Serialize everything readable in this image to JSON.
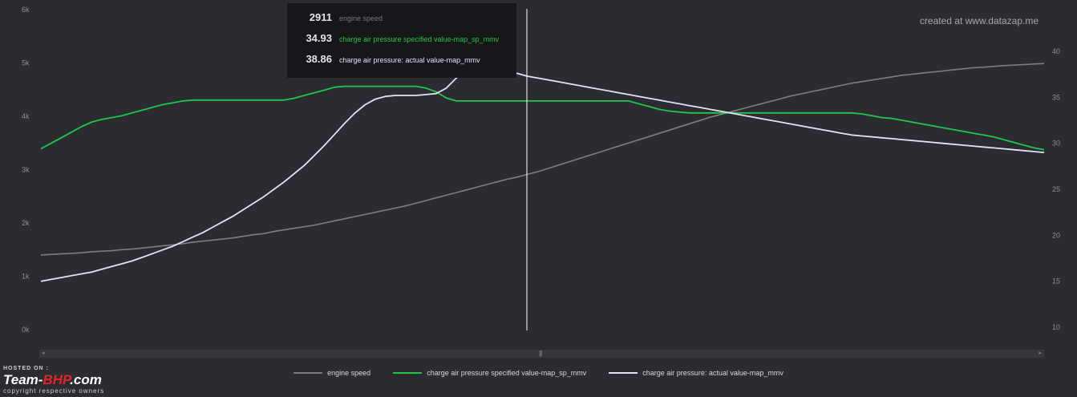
{
  "watermark": "created at www.datazap.me",
  "tooltip": {
    "rows": [
      {
        "value": "2911",
        "name": "engine speed",
        "color": "#8b8b8f"
      },
      {
        "value": "34.93",
        "name": "charge air pressure specified value-map_sp_mmv",
        "color": "#21c64a"
      },
      {
        "value": "38.86",
        "name": "charge air pressure: actual value-map_mmv",
        "color": "#e4e1f5"
      }
    ]
  },
  "scrollbar": {
    "left_arrow": "◂",
    "right_arrow": "▸",
    "grip": "|||"
  },
  "brand": {
    "hosted": "HOSTED ON :",
    "name_a": "Team-",
    "name_b": "BHP",
    "name_c": ".com",
    "copyright": "copyright respective owners"
  },
  "chart_data": {
    "type": "line",
    "x_count": 100,
    "cursor_index": 39,
    "left_axis": {
      "min": 0,
      "max": 6000,
      "ticks": [
        0,
        1000,
        2000,
        3000,
        4000,
        5000,
        6000
      ],
      "tick_labels": [
        "0k",
        "1k",
        "2k",
        "3k",
        "4k",
        "5k",
        "6k"
      ]
    },
    "right_axis": {
      "min": 10,
      "max": 40,
      "ticks": [
        10,
        15,
        20,
        25,
        30,
        35,
        40
      ],
      "tick_labels": [
        "10",
        "15",
        "20",
        "25",
        "30",
        "35",
        "40"
      ]
    },
    "legend": [
      "engine speed",
      "charge air pressure specified value-map_sp_mmv",
      "charge air pressure: actual value-map_mmv"
    ],
    "series": [
      {
        "name": "engine speed",
        "axis": "left",
        "color": "#7e7e82",
        "values": [
          1400,
          1410,
          1420,
          1430,
          1440,
          1460,
          1470,
          1480,
          1500,
          1510,
          1530,
          1550,
          1570,
          1590,
          1610,
          1640,
          1660,
          1680,
          1700,
          1720,
          1750,
          1780,
          1800,
          1840,
          1870,
          1900,
          1930,
          1960,
          2000,
          2040,
          2080,
          2120,
          2160,
          2200,
          2240,
          2280,
          2320,
          2370,
          2420,
          2470,
          2520,
          2570,
          2620,
          2670,
          2720,
          2770,
          2820,
          2860,
          2911,
          2960,
          3020,
          3080,
          3140,
          3200,
          3260,
          3320,
          3380,
          3440,
          3500,
          3560,
          3620,
          3680,
          3740,
          3800,
          3860,
          3920,
          3980,
          4030,
          4080,
          4130,
          4180,
          4230,
          4280,
          4330,
          4380,
          4420,
          4460,
          4500,
          4540,
          4580,
          4620,
          4650,
          4680,
          4710,
          4740,
          4770,
          4790,
          4810,
          4830,
          4850,
          4870,
          4890,
          4910,
          4920,
          4935,
          4950,
          4960,
          4970,
          4980,
          4990
        ]
      },
      {
        "name": "charge air pressure specified value-map_sp_mmv",
        "axis": "right",
        "color": "#21c64a",
        "values": [
          29.4,
          30.0,
          30.6,
          31.2,
          31.8,
          32.3,
          32.6,
          32.8,
          33.0,
          33.3,
          33.6,
          33.9,
          34.2,
          34.4,
          34.6,
          34.7,
          34.7,
          34.7,
          34.7,
          34.7,
          34.7,
          34.7,
          34.7,
          34.7,
          34.7,
          34.9,
          35.2,
          35.5,
          35.8,
          36.1,
          36.2,
          36.2,
          36.2,
          36.2,
          36.2,
          36.2,
          36.2,
          36.2,
          36.0,
          35.6,
          34.93,
          34.6,
          34.6,
          34.6,
          34.6,
          34.6,
          34.6,
          34.6,
          34.6,
          34.6,
          34.6,
          34.6,
          34.6,
          34.6,
          34.6,
          34.6,
          34.6,
          34.6,
          34.6,
          34.3,
          34.0,
          33.7,
          33.5,
          33.4,
          33.3,
          33.3,
          33.3,
          33.3,
          33.3,
          33.3,
          33.3,
          33.3,
          33.3,
          33.3,
          33.3,
          33.3,
          33.3,
          33.3,
          33.3,
          33.3,
          33.3,
          33.2,
          33.0,
          32.8,
          32.7,
          32.5,
          32.3,
          32.1,
          31.9,
          31.7,
          31.5,
          31.3,
          31.1,
          30.9,
          30.7,
          30.4,
          30.1,
          29.8,
          29.5,
          29.3
        ]
      },
      {
        "name": "charge air pressure: actual value-map_mmv",
        "axis": "right",
        "color": "#e4e1f5",
        "values": [
          15.0,
          15.2,
          15.4,
          15.6,
          15.8,
          16.0,
          16.3,
          16.6,
          16.9,
          17.2,
          17.6,
          18.0,
          18.4,
          18.8,
          19.3,
          19.8,
          20.3,
          20.9,
          21.5,
          22.1,
          22.8,
          23.5,
          24.2,
          25.0,
          25.8,
          26.7,
          27.6,
          28.7,
          29.8,
          31.0,
          32.2,
          33.3,
          34.2,
          34.8,
          35.1,
          35.2,
          35.2,
          35.2,
          35.3,
          35.4,
          36.0,
          37.1,
          38.1,
          38.86,
          38.7,
          38.3,
          37.9,
          37.6,
          37.3,
          37.1,
          36.9,
          36.7,
          36.5,
          36.3,
          36.1,
          35.9,
          35.7,
          35.5,
          35.3,
          35.1,
          34.9,
          34.7,
          34.5,
          34.3,
          34.1,
          33.9,
          33.7,
          33.5,
          33.3,
          33.1,
          32.9,
          32.7,
          32.5,
          32.3,
          32.1,
          31.9,
          31.7,
          31.5,
          31.3,
          31.1,
          30.9,
          30.8,
          30.7,
          30.6,
          30.5,
          30.4,
          30.3,
          30.2,
          30.1,
          30.0,
          29.9,
          29.8,
          29.7,
          29.6,
          29.5,
          29.4,
          29.3,
          29.2,
          29.1,
          29.0
        ]
      }
    ]
  }
}
